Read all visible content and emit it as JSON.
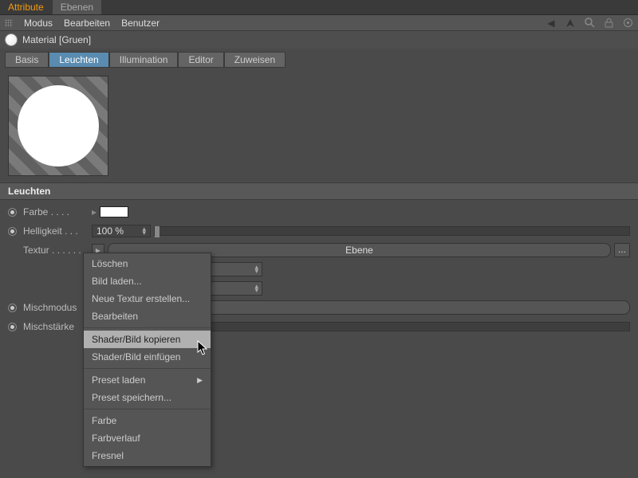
{
  "topTabs": {
    "attribute": "Attribute",
    "ebenen": "Ebenen"
  },
  "menu": {
    "modus": "Modus",
    "bearbeiten": "Bearbeiten",
    "benutzer": "Benutzer"
  },
  "material": {
    "label": "Material [Gruen]"
  },
  "channels": {
    "basis": "Basis",
    "leuchten": "Leuchten",
    "illumination": "Illumination",
    "editor": "Editor",
    "zuweisen": "Zuweisen"
  },
  "section": "Leuchten",
  "props": {
    "farbe": "Farbe",
    "helligkeit": "Helligkeit",
    "helligkeit_val": "100 %",
    "textur": "Textur",
    "textur_val": "Ebene",
    "mischmodus": "Mischmodus",
    "mischstaerke": "Mischstärke",
    "dots": ". . . . . .",
    "dots2": ". . . .",
    "dots3": ". . ."
  },
  "ctx": {
    "loeschen": "Löschen",
    "bild_laden": "Bild laden...",
    "neue_textur": "Neue Textur erstellen...",
    "bearbeiten": "Bearbeiten",
    "shader_kopieren": "Shader/Bild kopieren",
    "shader_einfuegen": "Shader/Bild einfügen",
    "preset_laden": "Preset laden",
    "preset_speichern": "Preset speichern...",
    "farbe": "Farbe",
    "farbverlauf": "Farbverlauf",
    "fresnel": "Fresnel"
  },
  "glyph": {
    "triangle_play": "▶",
    "triangle_left": "◀",
    "spin": "◂▸",
    "browse": "..."
  }
}
